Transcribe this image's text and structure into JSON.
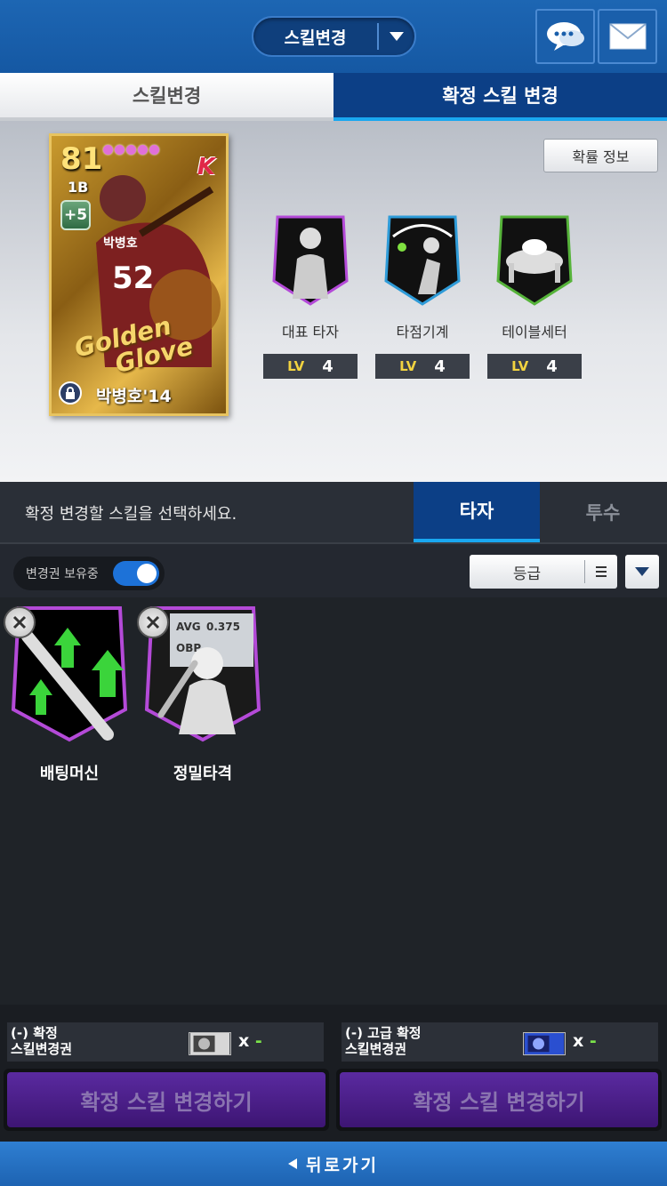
{
  "header": {
    "mode_label": "스킬변경",
    "chat_icon": "chat-bubble-icon",
    "mail_icon": "mail-icon"
  },
  "tabs": [
    {
      "label": "스킬변경",
      "active": false
    },
    {
      "label": "확정 스킬 변경",
      "active": true
    }
  ],
  "card_area": {
    "probability_button": "확률 정보",
    "player": {
      "rating": "81",
      "position": "1B",
      "upgrade": "+5",
      "team_logo": "K",
      "script_text_1": "Golden",
      "script_text_2": "Glove",
      "jersey_name": "박병호",
      "jersey_number": "52",
      "name": "박병호'14"
    },
    "skills": [
      {
        "name": "대표 타자",
        "lv_tag": "LV",
        "level": "4",
        "border": "#b44ad8"
      },
      {
        "name": "타점기계",
        "lv_tag": "LV",
        "level": "4",
        "border": "#2e9bd8"
      },
      {
        "name": "테이블세터",
        "lv_tag": "LV",
        "level": "4",
        "border": "#56b33a"
      }
    ]
  },
  "selection": {
    "prompt": "확정 변경할 스킬을 선택하세요.",
    "tabs": [
      {
        "label": "타자",
        "active": true
      },
      {
        "label": "투수",
        "active": false
      }
    ]
  },
  "filter": {
    "toggle_label": "변경권 보유중",
    "toggle_on": true,
    "grade_label": "등급"
  },
  "skill_list": [
    {
      "name": "배팅머신"
    },
    {
      "name": "정밀타격",
      "stat_1": "AVG",
      "stat_1_val": "0.375",
      "stat_2": "OBP"
    }
  ],
  "tickets": [
    {
      "label_line1": "(-) 확정",
      "label_line2": "스킬변경권",
      "count_prefix": "x",
      "count": "-",
      "button": "확정 스킬 변경하기"
    },
    {
      "label_line1": "(-) 고급 확정",
      "label_line2": "스킬변경권",
      "count_prefix": "x",
      "count": "-",
      "button": "확정 스킬 변경하기"
    }
  ],
  "footer": {
    "back_label": "뒤로가기"
  },
  "colors": {
    "topbar": "#1d66b3",
    "tab_active": "#0c3f86",
    "accent_line": "#19a7f0",
    "action_button": "#5a2aa0",
    "lv_yellow": "#f2d340"
  }
}
